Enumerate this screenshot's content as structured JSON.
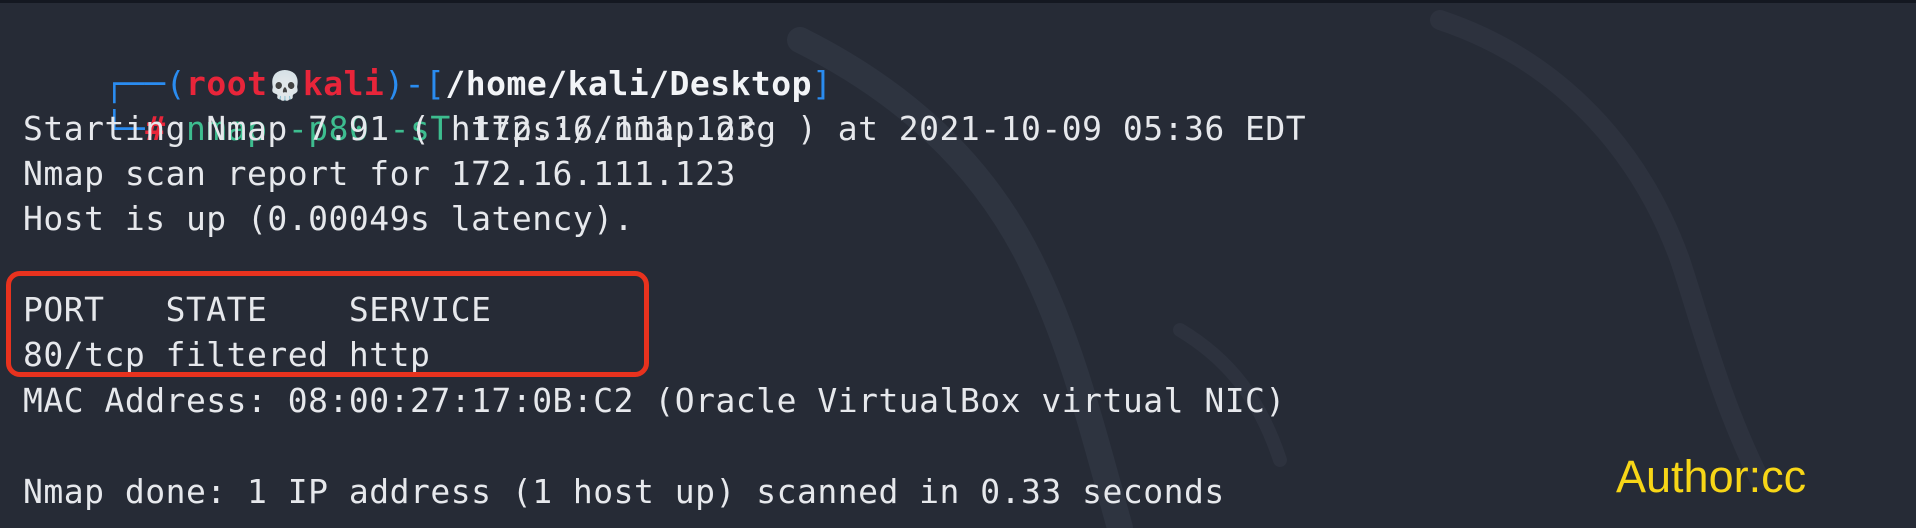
{
  "prompt": {
    "corner_top": "┌──(",
    "user": "root",
    "skull": "💀",
    "host": "kali",
    "mid": ")-[",
    "path": "/home/kali/Desktop",
    "end": "]",
    "corner_bottom": "└─",
    "hash": "#"
  },
  "command": {
    "program": "nmap",
    "flags": "-p80 -sT",
    "target": "172.16.111.123"
  },
  "output": {
    "starting": "Starting Nmap 7.91 ( https://nmap.org ) at 2021-10-09 05:36 EDT",
    "report": "Nmap scan report for 172.16.111.123",
    "host_up": "Host is up (0.00049s latency).",
    "table_header": "PORT   STATE    SERVICE",
    "table_row": "80/tcp filtered http",
    "mac": "MAC Address: 08:00:27:17:0B:C2 (Oracle VirtualBox virtual NIC)",
    "done": "Nmap done: 1 IP address (1 host up) scanned in 0.33 seconds"
  },
  "annotation": {
    "author": "Author:cc"
  },
  "colors": {
    "background": "#262b36",
    "prompt_frame": "#2a8cf0",
    "prompt_user": "#e8253a",
    "command": "#3dbd8f",
    "highlight": "#e8321e",
    "author": "#f7d617"
  }
}
